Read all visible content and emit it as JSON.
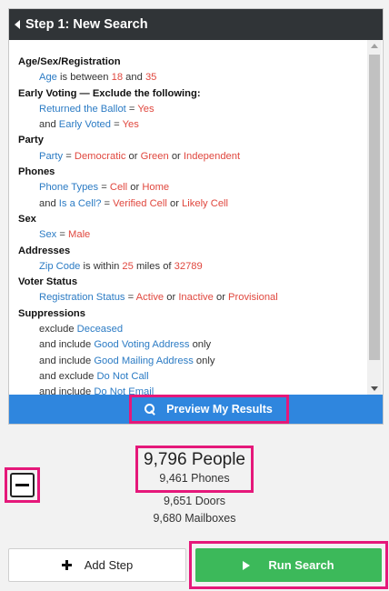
{
  "header": {
    "title": "Step 1: New Search"
  },
  "criteria": [
    {
      "title": "Age/Sex/Registration",
      "lines": [
        [
          [
            "k",
            "Age"
          ],
          [
            "t",
            " is between "
          ],
          [
            "v",
            "18"
          ],
          [
            "t",
            " and "
          ],
          [
            "v",
            "35"
          ]
        ]
      ]
    },
    {
      "title": "Early Voting — Exclude the following:",
      "lines": [
        [
          [
            "k",
            "Returned the Ballot"
          ],
          [
            "t",
            " = "
          ],
          [
            "v",
            "Yes"
          ]
        ],
        [
          [
            "t",
            "and "
          ],
          [
            "k",
            "Early Voted"
          ],
          [
            "t",
            " = "
          ],
          [
            "v",
            "Yes"
          ]
        ]
      ]
    },
    {
      "title": "Party",
      "lines": [
        [
          [
            "k",
            "Party"
          ],
          [
            "t",
            " = "
          ],
          [
            "v",
            "Democratic"
          ],
          [
            "t",
            " or "
          ],
          [
            "v",
            "Green"
          ],
          [
            "t",
            " or "
          ],
          [
            "v",
            "Independent"
          ]
        ]
      ]
    },
    {
      "title": "Phones",
      "lines": [
        [
          [
            "k",
            "Phone Types"
          ],
          [
            "t",
            " = "
          ],
          [
            "v",
            "Cell"
          ],
          [
            "t",
            " or "
          ],
          [
            "v",
            "Home"
          ]
        ],
        [
          [
            "t",
            "and "
          ],
          [
            "k",
            "Is a Cell?"
          ],
          [
            "t",
            " = "
          ],
          [
            "v",
            "Verified Cell"
          ],
          [
            "t",
            " or "
          ],
          [
            "v",
            "Likely Cell"
          ]
        ]
      ]
    },
    {
      "title": "Sex",
      "lines": [
        [
          [
            "k",
            "Sex"
          ],
          [
            "t",
            " = "
          ],
          [
            "v",
            "Male"
          ]
        ]
      ]
    },
    {
      "title": "Addresses",
      "lines": [
        [
          [
            "k",
            "Zip Code"
          ],
          [
            "t",
            " is within "
          ],
          [
            "v",
            "25"
          ],
          [
            "t",
            " miles of "
          ],
          [
            "v",
            "32789"
          ]
        ]
      ]
    },
    {
      "title": "Voter Status",
      "lines": [
        [
          [
            "k",
            "Registration Status"
          ],
          [
            "t",
            " = "
          ],
          [
            "v",
            "Active"
          ],
          [
            "t",
            " or "
          ],
          [
            "v",
            "Inactive"
          ],
          [
            "t",
            " or "
          ],
          [
            "v",
            "Provisional"
          ]
        ]
      ]
    },
    {
      "title": "Suppressions",
      "lines": [
        [
          [
            "t",
            "exclude "
          ],
          [
            "k",
            "Deceased"
          ]
        ],
        [
          [
            "t",
            "and include "
          ],
          [
            "k",
            "Good Voting Address"
          ],
          [
            "t",
            " only"
          ]
        ],
        [
          [
            "t",
            "and include "
          ],
          [
            "k",
            "Good Mailing Address"
          ],
          [
            "t",
            " only"
          ]
        ],
        [
          [
            "t",
            "and exclude "
          ],
          [
            "k",
            "Do Not Call"
          ]
        ],
        [
          [
            "t",
            "and include "
          ],
          [
            "k",
            "Do Not Email"
          ]
        ]
      ]
    }
  ],
  "preview": {
    "label": "Preview My Results"
  },
  "stats": {
    "people": "9,796 People",
    "phones": "9,461 Phones",
    "doors": "9,651 Doors",
    "mailboxes": "9,680 Mailboxes"
  },
  "actions": {
    "add_step": "Add Step",
    "run_search": "Run Search"
  },
  "colors": {
    "accent": "#2f86de",
    "run": "#3cb95a",
    "highlight": "#e5187a",
    "key": "#2b7bc4",
    "value": "#e0473e"
  },
  "icons": [
    "back-arrow-icon",
    "search-icon",
    "minus-icon",
    "plus-icon",
    "play-icon"
  ]
}
